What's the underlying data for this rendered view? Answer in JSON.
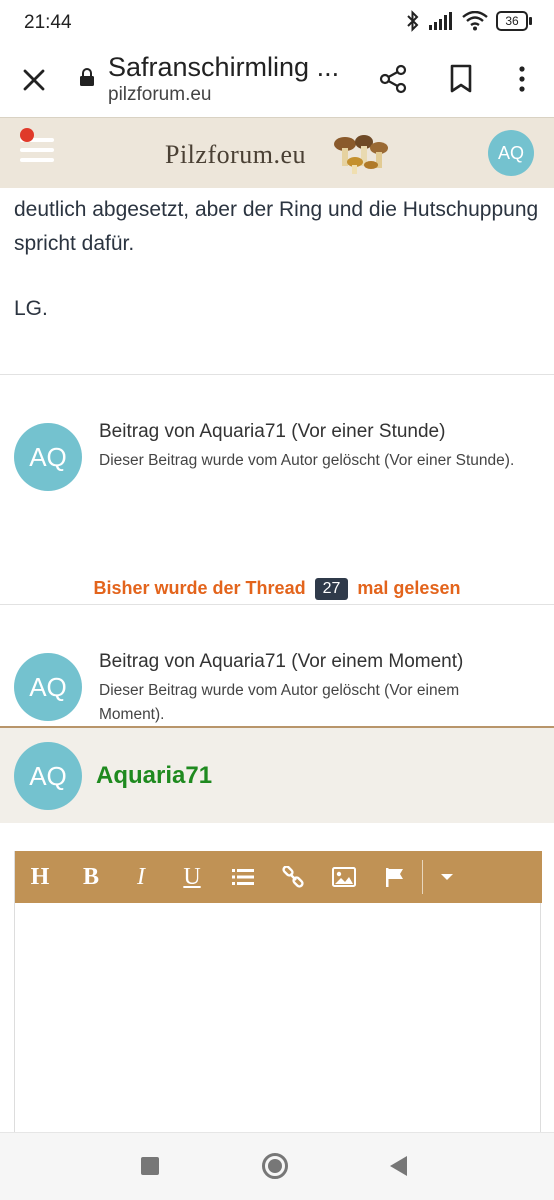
{
  "status_bar": {
    "time": "21:44",
    "battery": "36",
    "icons": [
      "bluetooth-icon",
      "signal-icon",
      "wifi-icon",
      "battery-icon"
    ]
  },
  "browser": {
    "page_title": "Safranschirmling ...",
    "url": "pilzforum.eu"
  },
  "site_header": {
    "logo_text": "Pilzforum.eu",
    "user_initials": "AQ",
    "notification_color": "#e03a2a"
  },
  "post": {
    "text": "deutlich abgesetzt, aber der Ring und die Hutschuppung spricht dafür.",
    "signoff": "LG."
  },
  "deleted_posts": [
    {
      "initials": "AQ",
      "heading": "Beitrag von Aquaria71 (Vor einer Stunde)",
      "body": "Dieser Beitrag wurde vom Autor gelöscht (Vor einer Stunde)."
    },
    {
      "initials": "AQ",
      "heading": "Beitrag von Aquaria71 (Vor einem Moment)",
      "body": "Dieser Beitrag wurde vom Autor gelöscht (Vor einem Moment)."
    }
  ],
  "read_count": {
    "prefix": "Bisher wurde der Thread",
    "count": "27",
    "suffix": "mal gelesen"
  },
  "reply": {
    "initials": "AQ",
    "username": "Aquaria71"
  },
  "editor_toolbar": {
    "heading": "H",
    "bold": "B",
    "italic": "I",
    "underline": "U",
    "buttons": [
      "heading",
      "bold",
      "italic",
      "underline",
      "list-icon",
      "link-icon",
      "image-icon",
      "flag-icon",
      "dropdown-icon"
    ]
  },
  "colors": {
    "header_bg": "#ede6da",
    "avatar": "#74c2cf",
    "read_count_text": "#e3641c",
    "username": "#1f8a1f",
    "toolbar": "#c09255"
  }
}
